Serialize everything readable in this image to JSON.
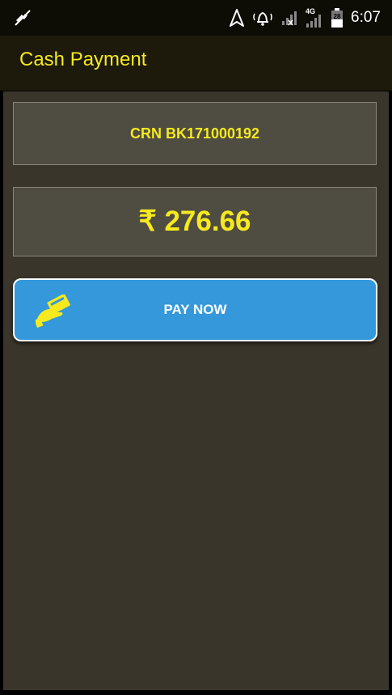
{
  "status_bar": {
    "time": "6:07",
    "battery_level": "28",
    "network_type": "4G",
    "icons": [
      "no-notifications-icon",
      "navigation-icon",
      "alarm-icon",
      "signal-icon",
      "signal-4g-icon",
      "battery-icon"
    ]
  },
  "app_bar": {
    "title": "Cash Payment"
  },
  "crn": {
    "text": "CRN BK171000192"
  },
  "amount": {
    "text": "₹ 276.66"
  },
  "pay_button": {
    "label": "PAY NOW",
    "icon": "hand-card-icon"
  },
  "colors": {
    "accent_yellow": "#f6ea1e",
    "button_blue": "#3498db",
    "background": "#39352a",
    "card": "#4f4c42",
    "app_bar": "#1d1a0b"
  }
}
